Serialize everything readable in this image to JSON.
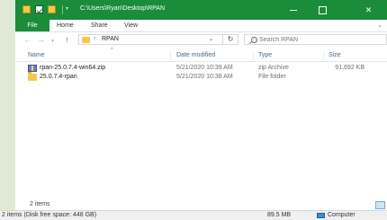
{
  "window": {
    "title": "C:\\Users\\Ryan\\Desktop\\RPAN",
    "quick_access_dropdown": "▾",
    "minimize_glyph": "—",
    "maximize_glyph": "☐",
    "close_glyph": "✕",
    "accent_color": "#1a8c3a"
  },
  "ribbon": {
    "tabs": [
      "File",
      "Home",
      "Share",
      "View"
    ],
    "expand_glyph": "⌄"
  },
  "nav": {
    "back_glyph": "←",
    "forward_glyph": "→",
    "history_glyph": "▾",
    "up_glyph": "↑",
    "address_separator": "›",
    "address_path": "RPAN",
    "address_dropdown": "⌄",
    "refresh_glyph": "↻",
    "search_placeholder": "Search RPAN"
  },
  "columns": {
    "name": "Name",
    "date_modified": "Date modified",
    "type": "Type",
    "size": "Size",
    "sort_caret": "^"
  },
  "files": [
    {
      "name": "rpan-25.0.7.4-win64.zip",
      "date_modified": "5/21/2020 10:39 AM",
      "type": "zip Archive",
      "size": "91,692 KB",
      "icon": "zip-archive-icon"
    },
    {
      "name": "25.0.7.4-rpan",
      "date_modified": "5/21/2020 10:38 AM",
      "type": "File folder",
      "size": "",
      "icon": "folder-icon"
    }
  ],
  "status": {
    "item_count": "2 items"
  },
  "details_bar": {
    "info": "2 items (Disk free space: 448 GB)",
    "total_size": "89.5 MB",
    "location": "Computer"
  }
}
